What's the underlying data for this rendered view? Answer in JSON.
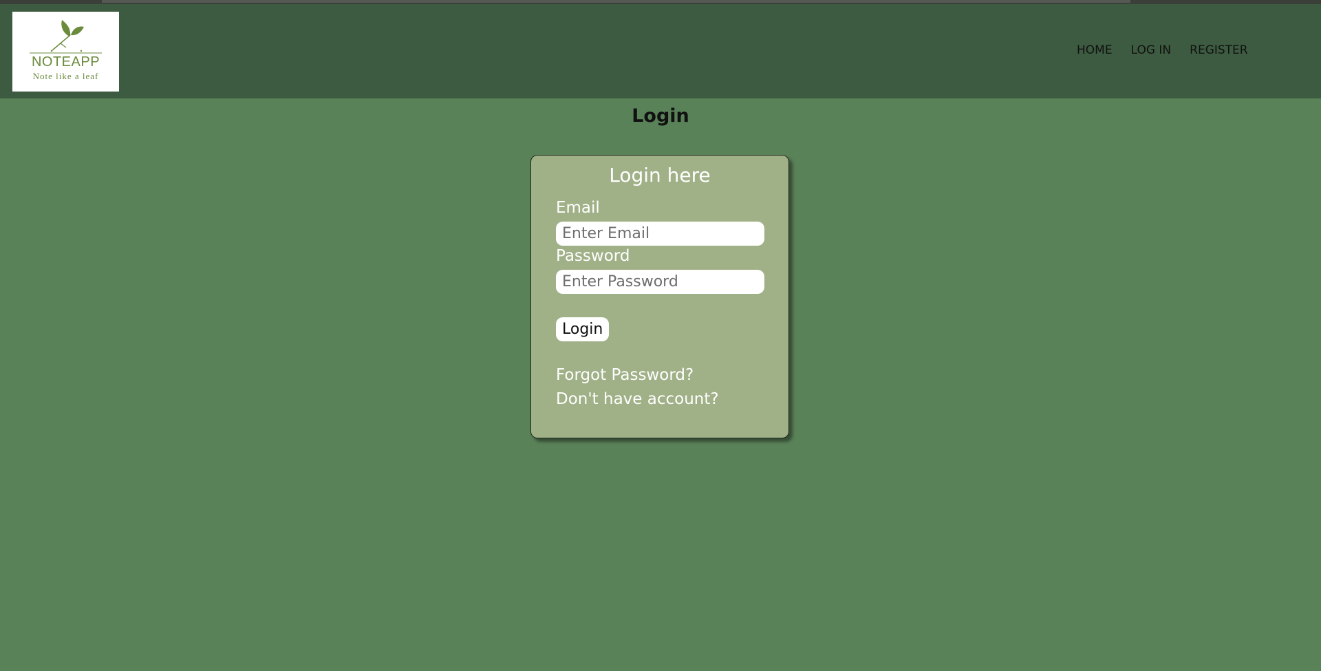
{
  "logo": {
    "brand": "NOTEAPP",
    "tagline": "Note like a leaf",
    "icon": "leaf-icon",
    "color": "#6a8a3c"
  },
  "nav": {
    "items": [
      {
        "label": "HOME"
      },
      {
        "label": "LOG IN"
      },
      {
        "label": "REGISTER"
      }
    ]
  },
  "page": {
    "title": "Login"
  },
  "login_form": {
    "title": "Login here",
    "email_label": "Email",
    "email_placeholder": "Enter Email",
    "email_value": "",
    "password_label": "Password",
    "password_placeholder": "Enter Password",
    "password_value": "",
    "submit_label": "Login",
    "forgot_link": "Forgot Password?",
    "register_link": "Don't have account?"
  },
  "colors": {
    "page_background": "#5a8258",
    "header_background": "#3c5b40",
    "card_background": "#a0b087"
  }
}
